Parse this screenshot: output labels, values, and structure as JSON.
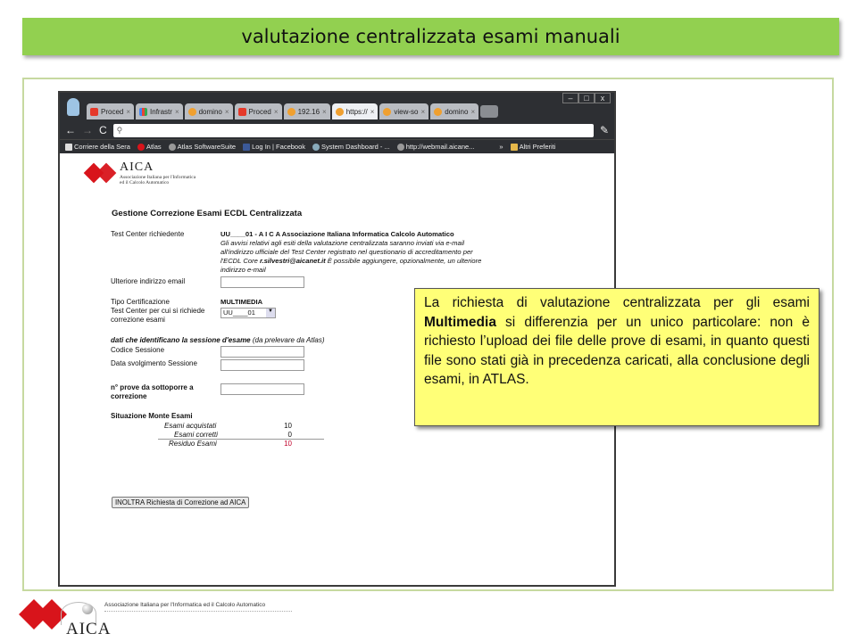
{
  "slide": {
    "title": "valutazione centralizzata esami manuali",
    "callout_parts": [
      "La richiesta di valutazione centralizzata per gli esami ",
      "Multimedia",
      " si differenzia per un unico particolare: non è richiesto l’upload dei file delle prove di esami, in quanto questi file sono stati già in precedenza caricati, alla conclusione degli esami, in ATLAS."
    ]
  },
  "browser": {
    "tabs": [
      {
        "label": "Proced",
        "icon": "aica-icon"
      },
      {
        "label": "Infrastr",
        "icon": "google-icon"
      },
      {
        "label": "domino",
        "icon": "domino-icon"
      },
      {
        "label": "Proced",
        "icon": "aica-icon"
      },
      {
        "label": "192.16",
        "icon": "domino-icon"
      },
      {
        "label": "https://",
        "icon": "domino-icon",
        "active": true
      },
      {
        "label": "view-so",
        "icon": "domino-icon"
      },
      {
        "label": "domino",
        "icon": "domino-icon"
      }
    ],
    "window_buttons": [
      "–",
      "□",
      "x"
    ],
    "omnibox_value": "",
    "bookmarks": [
      "Corriere della Sera",
      "Atlas",
      "Atlas SoftwareSuite",
      "Log In | Facebook",
      "System Dashboard - ...",
      "http://webmail.aicane...",
      "»",
      "Altri Preferiti"
    ]
  },
  "page": {
    "logo_big": "AICA",
    "logo_small_1": "Associazione Italiana per l'Informatica",
    "logo_small_2": "ed il Calcolo Automatico",
    "form_title": "Gestione Correzione Esami ECDL Centralizzata",
    "test_center_label": "Test Center richiedente",
    "test_center_value": "UU____01 - A I C A Associazione Italiana Informatica Calcolo Automatico",
    "notice_lines": [
      "Gli avvisi relativi agli esiti della valutazione centralizzata saranno inviati via e-mail",
      "all'indirizzo ufficiale del Test Center registrato nel questionario di accreditamento per",
      "l'ECDL Core ",
      "r.silvestri@aicanet.it",
      " È possibile aggiungere, opzionalmente, un ulteriore",
      "indirizzo e-mail"
    ],
    "email_label": "Ulteriore indirizzo email",
    "cert_type_label": "Tipo Certificazione",
    "cert_type_value": "MULTIMEDIA",
    "tc_request_label_1": "Test Center per cui si richiede",
    "tc_request_label_2": "correzione esami",
    "tc_select_value": "UU____01",
    "session_heading": "dati che identificano la sessione d'esame",
    "session_heading_note": " (da prelevare da Atlas)",
    "session_code_label": "Codice Sessione",
    "session_date_label": "Data svolgimento Sessione",
    "num_tests_label_1": "n° prove da sottoporre a",
    "num_tests_label_2": "correzione",
    "summary_title": "Situazione Monte Esami",
    "summary_rows": [
      {
        "label": "Esami acquistati",
        "value": "10"
      },
      {
        "label": "Esami corretti",
        "value": "0"
      },
      {
        "label": "Residuo Esami",
        "value": "10"
      }
    ],
    "submit_label": "INOLTRA Richiesta di Correzione ad AICA"
  },
  "footer": {
    "org_name": "Associazione Italiana per l'Informatica ed il Calcolo Automatico",
    "big": "AICA"
  },
  "colors": {
    "title_bar": "#92d050",
    "callout": "#ffff77",
    "brand_red": "#d8141b",
    "residuo": "#c0002a"
  }
}
